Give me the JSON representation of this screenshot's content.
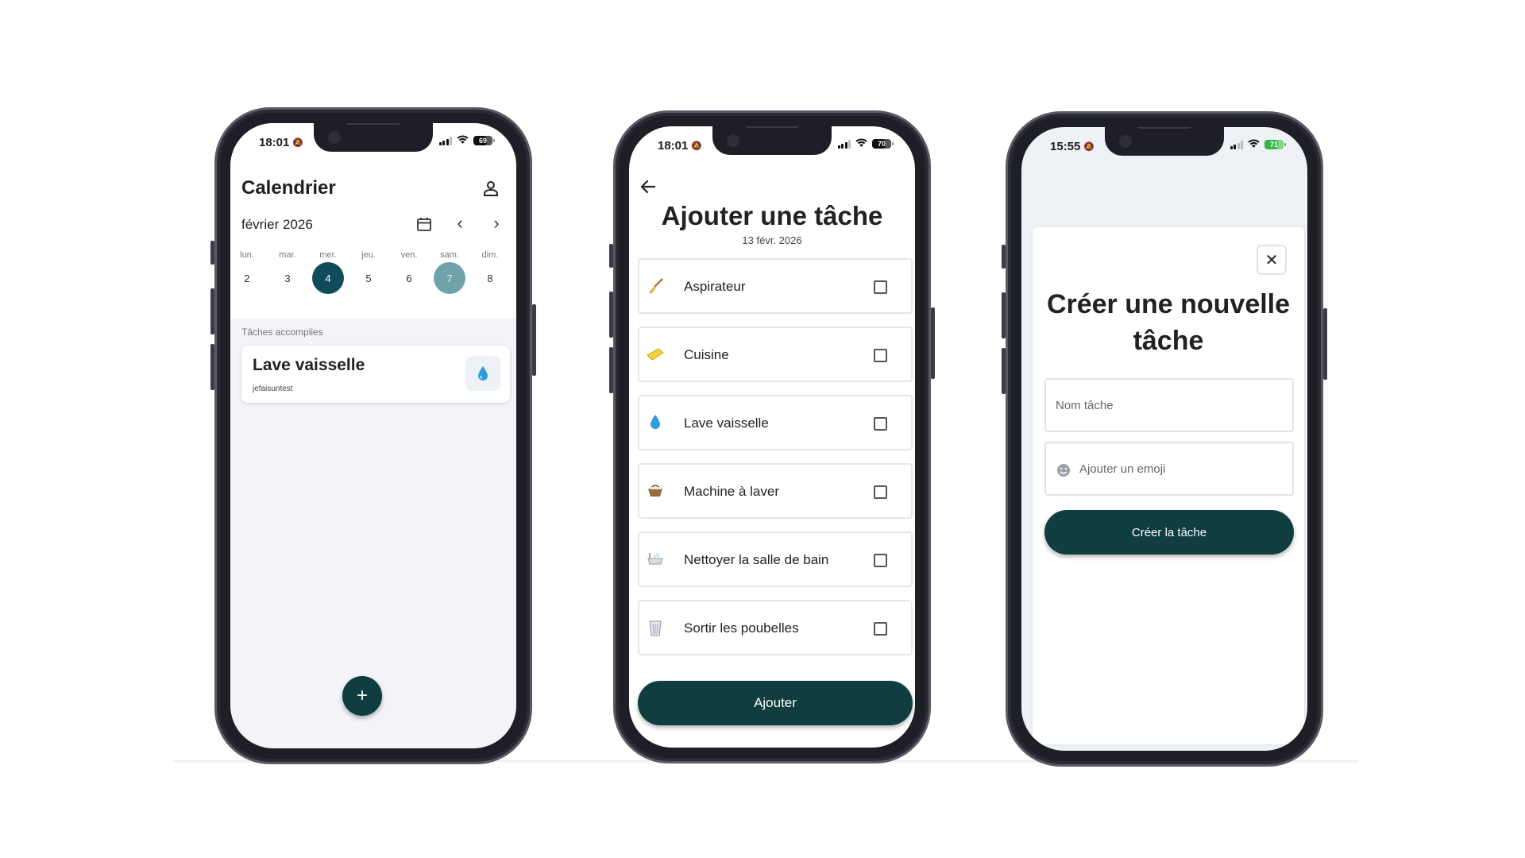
{
  "colors": {
    "primary": "#0f3d40",
    "selected_day": "#0f4c5c",
    "weekend_day": "#6fa3a9",
    "screen_bg": "#f2f4f8",
    "water_drop": "#2f9be0"
  },
  "phone1": {
    "status": {
      "time": "18:01",
      "battery": "69"
    },
    "title": "Calendrier",
    "month": "février 2026",
    "days": [
      {
        "name": "lun.",
        "num": "2"
      },
      {
        "name": "mar.",
        "num": "3"
      },
      {
        "name": "mer.",
        "num": "4",
        "state": "selected"
      },
      {
        "name": "jeu.",
        "num": "5"
      },
      {
        "name": "ven.",
        "num": "6"
      },
      {
        "name": "sam.",
        "num": "7",
        "state": "highlighted"
      },
      {
        "name": "dim.",
        "num": "8"
      }
    ],
    "section_label": "Tâches accomplies",
    "task_card": {
      "title": "Lave vaisselle",
      "subtitle": "jefaisuntest",
      "icon": "water-drop-icon"
    },
    "fab": {
      "label": "+"
    }
  },
  "phone2": {
    "status": {
      "time": "18:01",
      "battery": "70"
    },
    "title": "Ajouter une tâche",
    "date": "13 févr. 2026",
    "tasks": [
      {
        "label": "Aspirateur",
        "icon": "broom-icon"
      },
      {
        "label": "Cuisine",
        "icon": "sponge-icon"
      },
      {
        "label": "Lave vaisselle",
        "icon": "water-drop-icon"
      },
      {
        "label": "Machine à laver",
        "icon": "basket-icon"
      },
      {
        "label": "Nettoyer la salle de bain",
        "icon": "bathtub-icon"
      },
      {
        "label": "Sortir les poubelles",
        "icon": "wastebasket-icon"
      }
    ],
    "add_button": "Ajouter"
  },
  "phone3": {
    "status": {
      "time": "15:55",
      "battery": "71"
    },
    "title": "Créer une nouvelle tâche",
    "name_placeholder": "Nom tâche",
    "emoji_placeholder": "Ajouter un emoji",
    "create_button": "Créer la tâche",
    "close_label": "✕"
  }
}
